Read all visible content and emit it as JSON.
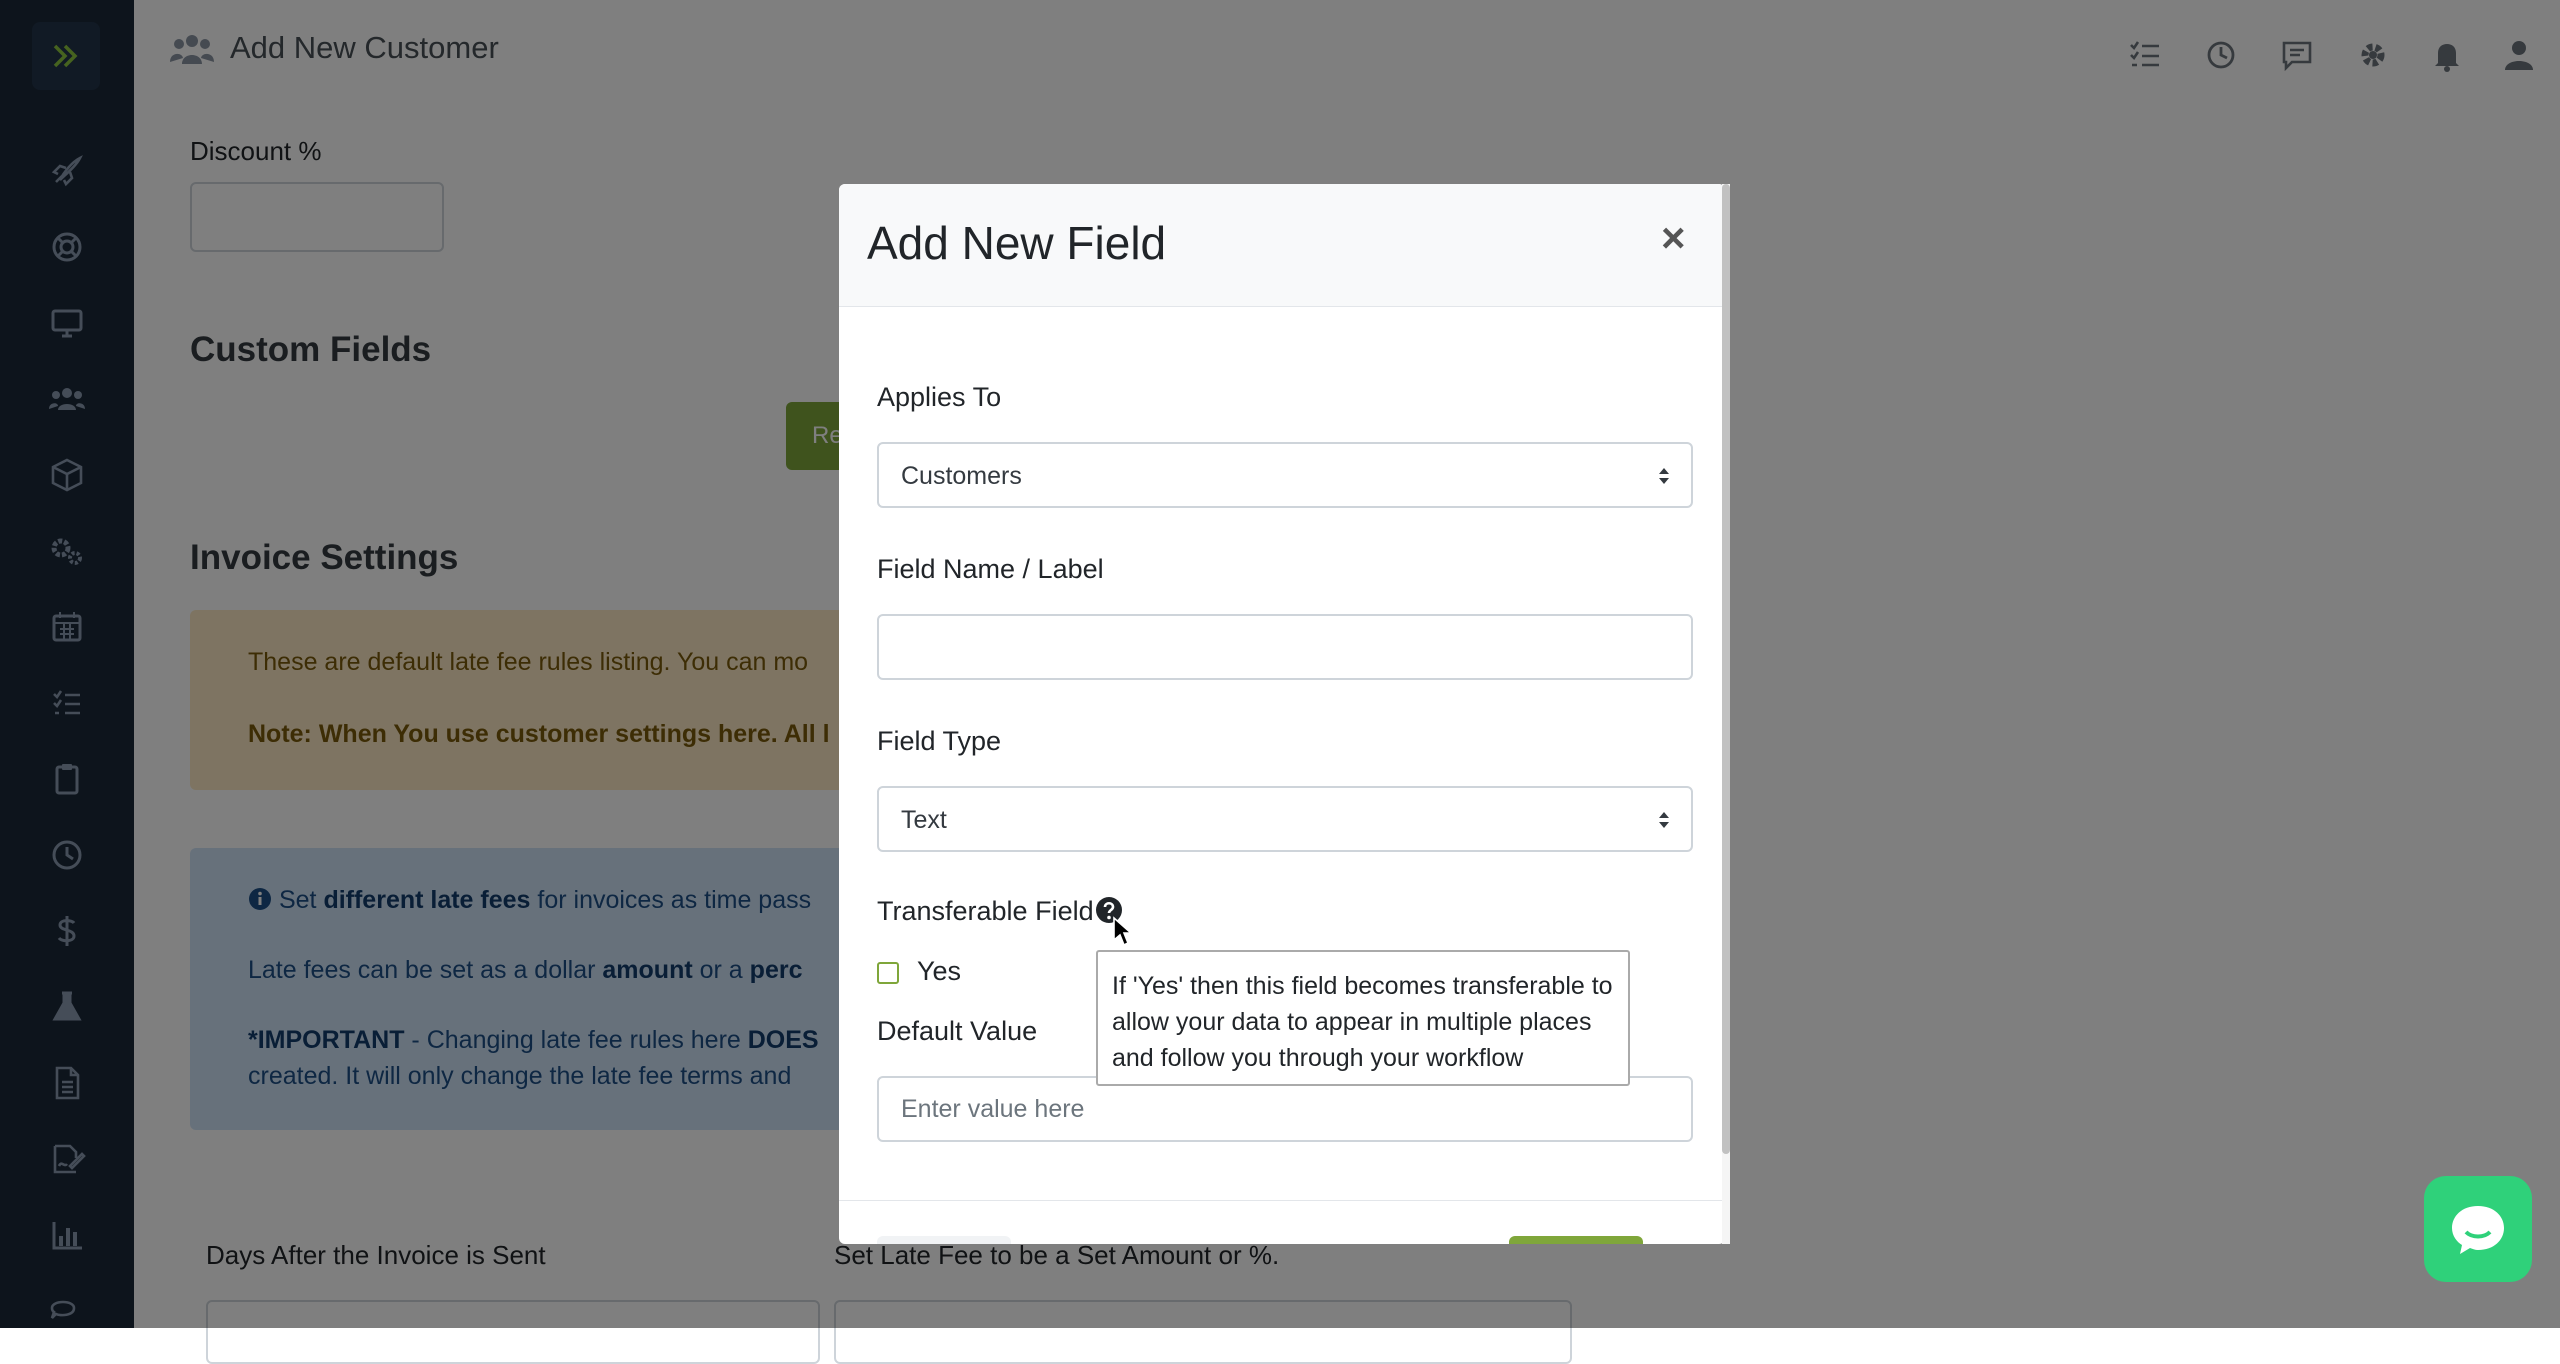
{
  "topbar": {
    "title": "Add New Customer",
    "icons": [
      "tasks-icon",
      "clock-icon",
      "chat-icon",
      "gear-icon",
      "bell-icon",
      "user-icon"
    ]
  },
  "sidebar": {
    "items": [
      "rocket-icon",
      "lifebuoy-icon",
      "desktop-icon",
      "users-icon",
      "box-icon",
      "cogs-icon",
      "calendar-icon",
      "list-icon",
      "clipboard-icon",
      "clock-icon",
      "dollar-icon",
      "flask-icon",
      "document-icon",
      "signature-icon",
      "chart-icon",
      "comments-icon"
    ]
  },
  "background_form": {
    "discount_label": "Discount %",
    "custom_fields_heading": "Custom Fields",
    "custom_fields_button": "Re",
    "invoice_settings_heading": "Invoice Settings",
    "warning_line1": "These are default late fee rules listing. You can mo",
    "warning_line2": "Note: When You use customer settings here. All l",
    "info_line1_pre": "Set ",
    "info_line1_bold": "different late fees",
    "info_line1_post": " for invoices as time pass",
    "info_line2_pre": "Late fees can be set as a dollar ",
    "info_line2_bold1": "amount",
    "info_line2_mid": " or a ",
    "info_line2_bold2": "perc",
    "info_line3_bold": "*IMPORTANT",
    "info_line3_mid": " - Changing late fee rules here ",
    "info_line3_bold2": "DOES",
    "info_line4": "created. It will only change the late fee terms and",
    "days_label": "Days After the Invoice is Sent",
    "late_fee_label": "Set Late Fee to be a Set Amount or %."
  },
  "modal": {
    "title": "Add New Field",
    "close_label": "×",
    "applies_to_label": "Applies To",
    "applies_to_value": "Customers",
    "field_name_label": "Field Name / Label",
    "field_name_value": "",
    "field_type_label": "Field Type",
    "field_type_value": "Text",
    "transferable_label": "Transferable Field",
    "yes_label": "Yes",
    "default_value_label": "Default Value",
    "default_value_placeholder": "Enter value here"
  },
  "tooltip": {
    "text": "If 'Yes' then this field becomes transferable to allow your data to appear in multiple places and follow you through your workflow"
  },
  "colors": {
    "sidebar": "#1b2838",
    "accent_green": "#7fa63a",
    "chat_green": "#2fd17a"
  }
}
